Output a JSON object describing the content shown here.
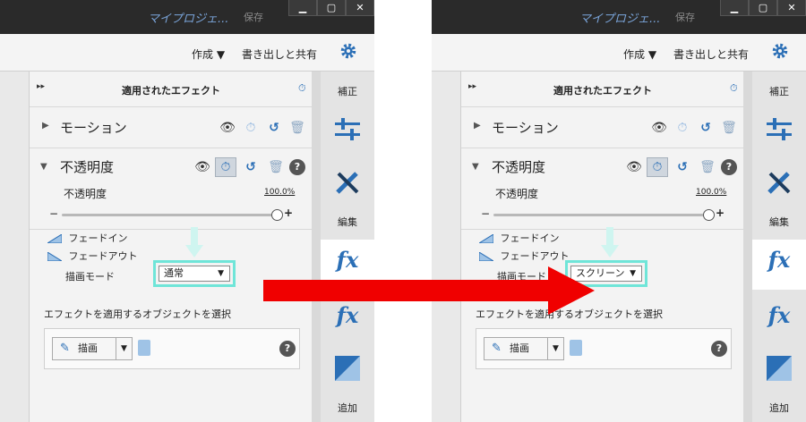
{
  "window": {
    "project_name": "マイプロジェ...",
    "save_label": "保存",
    "min_glyph": "▁",
    "max_glyph": "▢",
    "close_glyph": "✕"
  },
  "toolbar": {
    "create_label": "作成 ▼",
    "share_label": "書き出しと共有"
  },
  "effects_panel": {
    "collapse_glyph": "▸▸",
    "title": "適用されたエフェクト",
    "motion": {
      "label": "モーション",
      "expand_glyph": "▶"
    },
    "opacity": {
      "label": "不透明度",
      "expand_glyph": "▼",
      "param_label": "不透明度",
      "value": "100.0%",
      "slider_fraction": 1.0,
      "minus_glyph": "−",
      "plus_glyph": "+"
    },
    "fade_in_label": "フェードイン",
    "fade_out_label": "フェードアウト",
    "blend_mode_label": "描画モード",
    "apply_to_label": "エフェクトを適用するオブジェクトを選択",
    "draw_button_label": "描画",
    "draw_dropdown_glyph": "▼",
    "help_glyph": "?"
  },
  "icons": {
    "eye": "👁",
    "stopwatch": "⏱",
    "reset": "↺",
    "trash": "🗑",
    "pen": "✎",
    "caret": "▼"
  },
  "sidebar": {
    "adjust_label": "補正",
    "edit_label": "編集",
    "add_label": "追加",
    "fx_label": "fx"
  },
  "before": {
    "blend_mode_value": "通常"
  },
  "after": {
    "blend_mode_value": "スクリーン"
  },
  "colors": {
    "accent_blue": "#2b6fb6",
    "highlight_cyan": "#6fe5d8",
    "arrow_red": "#f00000",
    "titlebar": "#2a2a2a"
  }
}
